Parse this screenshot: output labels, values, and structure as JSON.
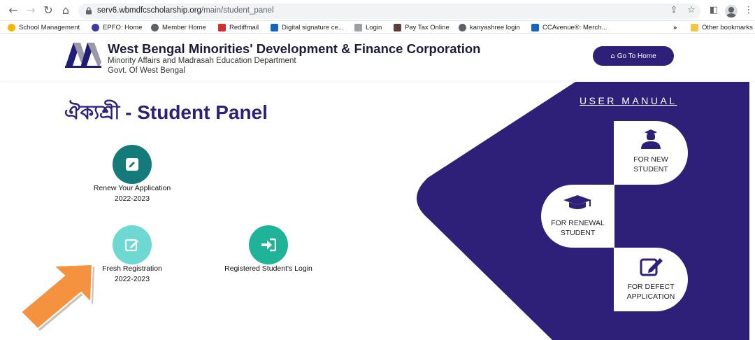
{
  "browser": {
    "url_host": "serv6.wbmdfcscholarship.org",
    "url_path": "/main/student_panel",
    "bookmarks": [
      {
        "label": "School Management",
        "icon": "school-management-favicon",
        "color": "#f4b400"
      },
      {
        "label": "EPFO: Home",
        "icon": "epfo-favicon",
        "color": "#3a3aa8"
      },
      {
        "label": "Member Home",
        "icon": "globe-icon",
        "color": "#5f6368"
      },
      {
        "label": "Rediffmail",
        "icon": "rediffmail-favicon",
        "color": "#d32f2f"
      },
      {
        "label": "Digital signature ce...",
        "icon": "digital-signature-favicon",
        "color": "#1565c0"
      },
      {
        "label": "Login",
        "icon": "document-icon",
        "color": "#9aa0a6"
      },
      {
        "label": "Pay Tax Online",
        "icon": "emblem-icon",
        "color": "#5d4037"
      },
      {
        "label": "kanyashree login",
        "icon": "globe-icon",
        "color": "#5f6368"
      },
      {
        "label": "CCAvenue®: Merch...",
        "icon": "ccavenue-favicon",
        "color": "#1565c0"
      }
    ],
    "more_bookmarks": "»",
    "other_bookmarks": "Other bookmarks"
  },
  "header": {
    "org_name": "West Bengal Minorities' Development & Finance Corporation",
    "department": "Minority Affairs and Madrasah Education Department",
    "government": "Govt. Of West Bengal",
    "home_button": "Go To Home"
  },
  "main": {
    "panel_title": "ঐক্যশ্রী - Student Panel",
    "actions": [
      {
        "line1": "Renew Your Application",
        "line2": "2022-2023",
        "icon": "edit-icon",
        "color": "#157a7a"
      },
      {
        "line1": "Fresh Registration",
        "line2": "2022-2023",
        "icon": "edit-icon",
        "color": "#6ed9d2"
      },
      {
        "line1": "Registered Student's Login",
        "line2": "",
        "icon": "login-icon",
        "color": "#1fb39a"
      }
    ]
  },
  "manual": {
    "title": "USER MANUAL",
    "items": [
      {
        "line1": "FOR NEW",
        "line2": "STUDENT",
        "icon": "student-icon"
      },
      {
        "line1": "FOR RENEWAL",
        "line2": "STUDENT",
        "icon": "graduation-cap-icon"
      },
      {
        "line1": "FOR DEFECT",
        "line2": "APPLICATION",
        "icon": "edit-icon"
      }
    ]
  },
  "colors": {
    "brand_purple": "#2e2079",
    "arrow_orange": "#f4923f"
  }
}
